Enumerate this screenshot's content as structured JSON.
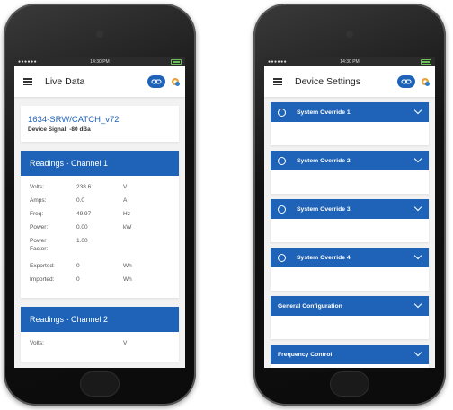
{
  "colors": {
    "accent": "#1e63b8",
    "background": "#f2f2f2"
  },
  "status_bar": {
    "time": "14:30 PM",
    "signal": "●●●●●●"
  },
  "live": {
    "title": "Live Data",
    "device_name": "1634-SRW/CATCH_v72",
    "device_signal": "Device Signal: -80 dBa",
    "channel1": {
      "title": "Readings - Channel 1",
      "rows": [
        {
          "label": "Volts:",
          "value": "238.6",
          "unit": "V"
        },
        {
          "label": "Amps:",
          "value": "0.0",
          "unit": "A"
        },
        {
          "label": "Freq:",
          "value": "49.97",
          "unit": "Hz"
        },
        {
          "label": "Power:",
          "value": "0.00",
          "unit": "kW"
        },
        {
          "label": "Power Factor:",
          "value": "1.00",
          "unit": ""
        },
        {
          "label": "Exported:",
          "value": "0",
          "unit": "Wh"
        },
        {
          "label": "Imported:",
          "value": "0",
          "unit": "Wh"
        }
      ]
    },
    "channel2": {
      "title": "Readings - Channel 2",
      "rows": [
        {
          "label": "Volts:",
          "value": "",
          "unit": "V"
        }
      ]
    }
  },
  "settings": {
    "title": "Device Settings",
    "sections": [
      {
        "label": "System Override 1"
      },
      {
        "label": "System Override 2"
      },
      {
        "label": "System Override 3"
      },
      {
        "label": "System Override 4"
      },
      {
        "label": "General Configuration"
      },
      {
        "label": "Frequency Control"
      }
    ]
  }
}
